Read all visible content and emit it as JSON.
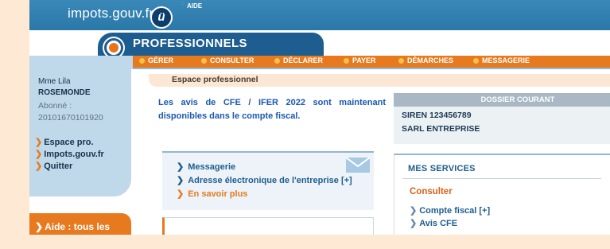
{
  "header": {
    "logo_text": "impots.gouv.fr",
    "logo_mark": "ü",
    "aide": "AIDE",
    "section_title": "PROFESSIONNELS"
  },
  "nav": {
    "items": [
      "GÉRER",
      "CONSULTER",
      "DÉCLARER",
      "PAYER",
      "DÉMARCHES",
      "MESSAGERIE"
    ]
  },
  "sidebar": {
    "user_line1": "Mme Lila",
    "user_line2": "ROSEMONDE",
    "abonne_label": "Abonné :",
    "abonne_number": "20101670101920",
    "links": [
      "Espace pro.",
      "Impots.gouv.fr",
      "Quitter"
    ],
    "aide_link": "Aide : tous les"
  },
  "main": {
    "breadcrumb": "Espace professionnel",
    "notice": "Les avis de CFE / IFER 2022 sont maintenant disponibles dans le compte fiscal.",
    "dossier": {
      "title": "DOSSIER COURANT",
      "siren": "SIREN 123456789",
      "company": "SARL ENTREPRISE"
    },
    "messages": {
      "items": [
        "Messagerie",
        "Adresse électronique de l'entreprise [+]",
        "En savoir plus"
      ]
    },
    "services": {
      "title": "MES SERVICES",
      "group": "Consulter",
      "links": [
        "Compte fiscal [+]",
        "Avis CFE"
      ]
    }
  },
  "colors": {
    "accent_orange": "#e77a1f",
    "brand_blue": "#1e5d8f",
    "link_blue": "#1a58b0",
    "page_background": "#fde9d4"
  },
  "icons": [
    "logo-mark-icon",
    "pro-circle-icon",
    "nav-dot-icon",
    "chevron-right-icon",
    "envelope-icon"
  ]
}
